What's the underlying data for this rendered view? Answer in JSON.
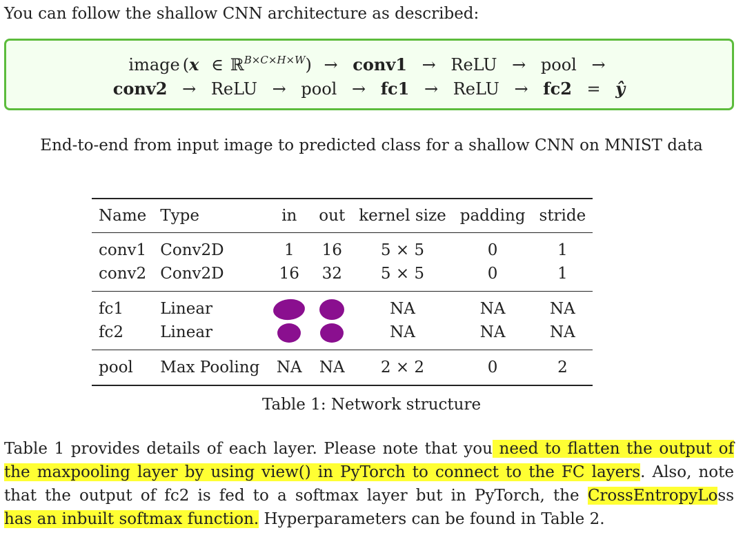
{
  "intro": "You can follow the shallow CNN architecture as described:",
  "architecture": {
    "line1": {
      "image_label": "image",
      "open_paren": "(",
      "x_var": "x",
      "in_symbol": "∈",
      "reals": "ℝ",
      "dims": "B×C×H×W",
      "close_paren": ")",
      "conv1": "conv1",
      "relu": "ReLU",
      "pool": "pool"
    },
    "line2": {
      "conv2": "conv2",
      "relu1": "ReLU",
      "pool": "pool",
      "fc1": "fc1",
      "relu2": "ReLU",
      "fc2": "fc2",
      "equals": "=",
      "yhat": "ŷ"
    },
    "arrow": "→"
  },
  "caption1": "End-to-end from input image to predicted class for a shallow CNN on MNIST data",
  "table": {
    "headers": [
      "Name",
      "Type",
      "in",
      "out",
      "kernel size",
      "padding",
      "stride"
    ],
    "rows": [
      {
        "name": "conv1",
        "type": "Conv2D",
        "in": "1",
        "out": "16",
        "kernel": "5 × 5",
        "padding": "0",
        "stride": "1"
      },
      {
        "name": "conv2",
        "type": "Conv2D",
        "in": "16",
        "out": "32",
        "kernel": "5 × 5",
        "padding": "0",
        "stride": "1"
      },
      {
        "name": "fc1",
        "type": "Linear",
        "in": "",
        "out": "",
        "kernel": "NA",
        "padding": "NA",
        "stride": "NA"
      },
      {
        "name": "fc2",
        "type": "Linear",
        "in": "",
        "out": "",
        "kernel": "NA",
        "padding": "NA",
        "stride": "NA"
      },
      {
        "name": "pool",
        "type": "Max Pooling",
        "in": "NA",
        "out": "NA",
        "kernel": "2 × 2",
        "padding": "0",
        "stride": "2"
      }
    ],
    "redaction_color": "#8a0f8f"
  },
  "caption2": "Table 1: Network structure",
  "paragraph": {
    "line1_a": "Table 1 provides details of each layer. Please note that you",
    "line1_b": " need to flatten the output of",
    "line2_a": "the maxpooling layer by using view() in PyTorch to connect to the FC layers",
    "line2_b": ". Also, note",
    "line3_a": "that the output of fc2 is fed to a softmax layer but in PyTorch, the ",
    "line3_b": "CrossEntropyLo",
    "line3_c": "ss",
    "line4_a": "has an inbuilt softmax function.",
    "line4_b": " Hyperparameters can be found in Table  2.",
    "highlight_color": "#ffff33"
  },
  "colors": {
    "box_border": "#5cbc3c",
    "box_fill": "#f4fff0"
  }
}
